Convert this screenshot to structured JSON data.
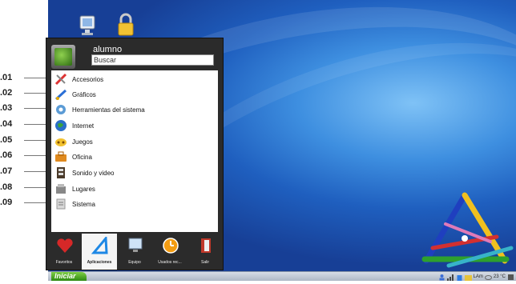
{
  "callouts": [
    ".01",
    ".02",
    ".03",
    ".04",
    ".05",
    ".06",
    ".07",
    ".08",
    ".09"
  ],
  "desktop": {
    "icons": [
      "monitor-icon",
      "padlock-icon"
    ],
    "wallpaper_logo": "crayon-triangle-logo"
  },
  "menu": {
    "username": "alumno",
    "search_value": "Buscar",
    "items": [
      {
        "label": "Accesorios",
        "icon": "accessories-icon"
      },
      {
        "label": "Gráficos",
        "icon": "graphics-icon"
      },
      {
        "label": "Herramientas del sistema",
        "icon": "system-tools-icon"
      },
      {
        "label": "Internet",
        "icon": "internet-globe-icon"
      },
      {
        "label": "Juegos",
        "icon": "games-icon"
      },
      {
        "label": "Oficina",
        "icon": "office-icon"
      },
      {
        "label": "Sonido y video",
        "icon": "sound-video-icon"
      },
      {
        "label": "Lugares",
        "icon": "places-icon"
      },
      {
        "label": "Sistema",
        "icon": "system-icon"
      }
    ],
    "bottom_tabs": [
      {
        "label": "Favoritos",
        "icon": "heart-icon",
        "active": false
      },
      {
        "label": "Aplicaciones",
        "icon": "applications-icon",
        "active": true
      },
      {
        "label": "Equipo",
        "icon": "computer-icon",
        "active": false
      },
      {
        "label": "Usados rec...",
        "icon": "clock-icon",
        "active": false
      },
      {
        "label": "Salir",
        "icon": "exit-icon",
        "active": false
      }
    ]
  },
  "taskbar": {
    "start_label": "Iniciar",
    "tray": {
      "keyboard": "LAm",
      "weather": "23 °C",
      "icons": [
        "user-icon",
        "signal-icon",
        "trash-icon",
        "folder-icon",
        "cloud-icon",
        "battery-icon"
      ]
    }
  },
  "colors": {
    "accent": "#2d8a12",
    "menu_bg": "#2b2b2b",
    "desktop": "#1f5fbf"
  }
}
